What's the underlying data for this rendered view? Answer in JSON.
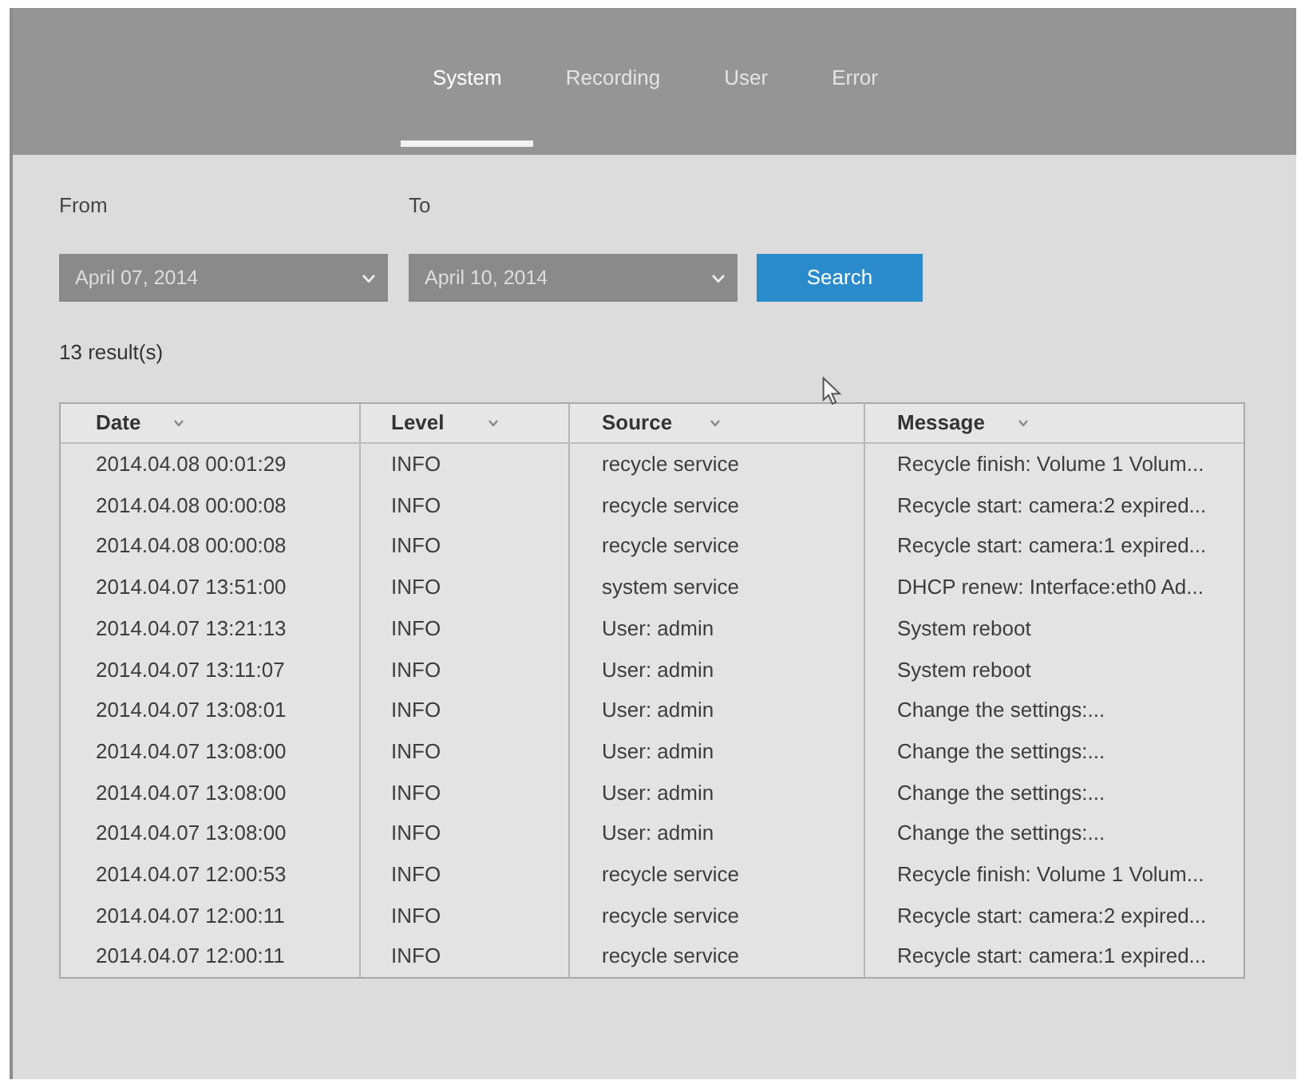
{
  "tabs": [
    {
      "label": "System",
      "selected": true
    },
    {
      "label": "Recording",
      "selected": false
    },
    {
      "label": "User",
      "selected": false
    },
    {
      "label": "Error",
      "selected": false
    }
  ],
  "filters": {
    "from": {
      "label": "From",
      "value": "April 07, 2014"
    },
    "to": {
      "label": "To",
      "value": "April 10, 2014"
    },
    "search_button": "Search"
  },
  "result_count": "13 result(s)",
  "table": {
    "columns": [
      "Date",
      "Level",
      "Source",
      "Message"
    ],
    "rows": [
      [
        "2014.04.08 00:01:29",
        "INFO",
        "recycle service",
        "Recycle finish: Volume 1 Volum..."
      ],
      [
        "2014.04.08 00:00:08",
        "INFO",
        "recycle service",
        "Recycle start: camera:2 expired..."
      ],
      [
        "2014.04.08 00:00:08",
        "INFO",
        "recycle service",
        "Recycle start: camera:1 expired..."
      ],
      [
        "2014.04.07 13:51:00",
        "INFO",
        "system service",
        "DHCP renew: Interface:eth0 Ad..."
      ],
      [
        "2014.04.07 13:21:13",
        "INFO",
        "User: admin",
        "System reboot"
      ],
      [
        "2014.04.07 13:11:07",
        "INFO",
        "User: admin",
        "System reboot"
      ],
      [
        "2014.04.07 13:08:01",
        "INFO",
        "User: admin",
        "Change the settings:..."
      ],
      [
        "2014.04.07 13:08:00",
        "INFO",
        "User: admin",
        "Change the settings:..."
      ],
      [
        "2014.04.07 13:08:00",
        "INFO",
        "User: admin",
        "Change the settings:..."
      ],
      [
        "2014.04.07 13:08:00",
        "INFO",
        "User: admin",
        "Change the settings:..."
      ],
      [
        "2014.04.07 12:00:53",
        "INFO",
        "recycle service",
        "Recycle finish: Volume 1 Volum..."
      ],
      [
        "2014.04.07 12:00:11",
        "INFO",
        "recycle service",
        "Recycle start: camera:2 expired..."
      ],
      [
        "2014.04.07 12:00:11",
        "INFO",
        "recycle service",
        "Recycle start: camera:1 expired..."
      ]
    ]
  }
}
